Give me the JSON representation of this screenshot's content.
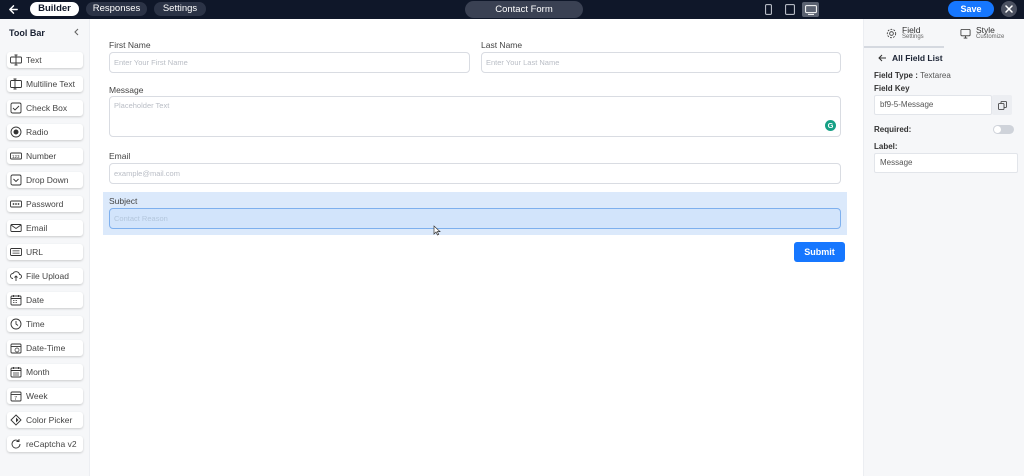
{
  "header": {
    "tabs": [
      {
        "label": "Builder",
        "active": true
      },
      {
        "label": "Responses",
        "active": false
      },
      {
        "label": "Settings",
        "active": false
      }
    ],
    "form_title": "Contact Form",
    "views": [
      "mobile-icon",
      "tablet-icon",
      "desktop-icon"
    ],
    "active_view": "desktop-icon",
    "save_label": "Save"
  },
  "toolbar": {
    "title": "Tool Bar",
    "items": [
      {
        "label": "Text",
        "icon": "text-icon"
      },
      {
        "label": "Multiline Text",
        "icon": "multiline-text-icon"
      },
      {
        "label": "Check Box",
        "icon": "checkbox-icon"
      },
      {
        "label": "Radio",
        "icon": "radio-icon"
      },
      {
        "label": "Number",
        "icon": "number-icon"
      },
      {
        "label": "Drop Down",
        "icon": "dropdown-icon"
      },
      {
        "label": "Password",
        "icon": "password-icon"
      },
      {
        "label": "Email",
        "icon": "email-icon"
      },
      {
        "label": "URL",
        "icon": "url-icon"
      },
      {
        "label": "File Upload",
        "icon": "file-upload-icon"
      },
      {
        "label": "Date",
        "icon": "date-icon"
      },
      {
        "label": "Time",
        "icon": "time-icon"
      },
      {
        "label": "Date-Time",
        "icon": "date-time-icon"
      },
      {
        "label": "Month",
        "icon": "month-icon"
      },
      {
        "label": "Week",
        "icon": "week-icon"
      },
      {
        "label": "Color Picker",
        "icon": "color-picker-icon"
      },
      {
        "label": "reCaptcha v2",
        "icon": "recaptcha-icon"
      }
    ]
  },
  "form": {
    "first_name": {
      "label": "First Name",
      "placeholder": "Enter Your First Name"
    },
    "last_name": {
      "label": "Last Name",
      "placeholder": "Enter Your Last Name"
    },
    "message": {
      "label": "Message",
      "placeholder": "Placeholder Text"
    },
    "email": {
      "label": "Email",
      "placeholder": "example@mail.com"
    },
    "subject": {
      "label": "Subject",
      "placeholder": "Contact Reason"
    },
    "submit_label": "Submit"
  },
  "panel": {
    "tab_field": {
      "title": "Field",
      "subtitle": "Settings"
    },
    "tab_style": {
      "title": "Style",
      "subtitle": "Customize"
    },
    "back_label": "All Field List",
    "field_type_label": "Field Type :",
    "field_type_value": "Textarea",
    "field_key_label": "Field Key",
    "field_key_value": "bf9-5-Message",
    "required_label": "Required:",
    "required_on": false,
    "label_label": "Label:",
    "label_value": "Message"
  },
  "colors": {
    "topbar": "#0f1729",
    "accent": "#1677ff",
    "selection": "#dbe9fb"
  }
}
